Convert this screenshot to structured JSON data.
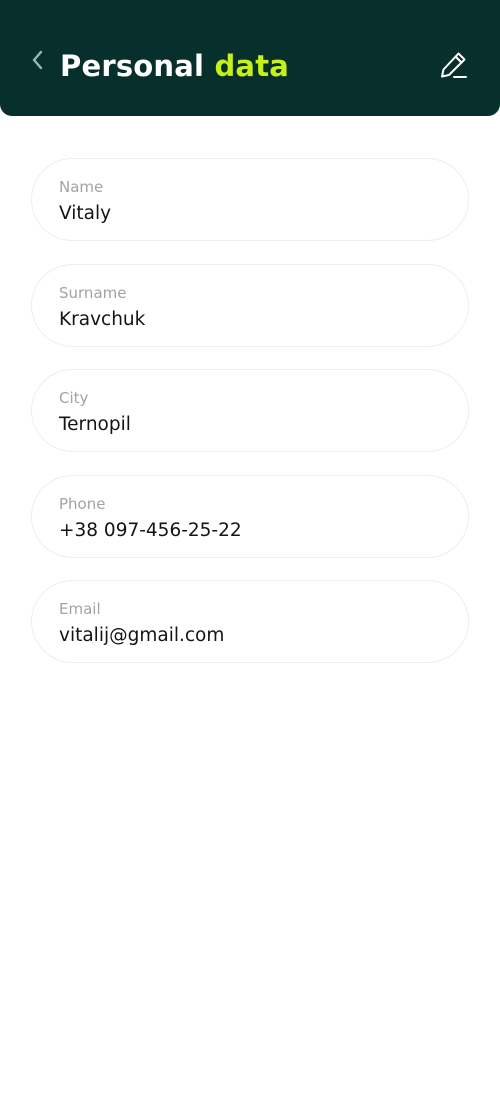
{
  "header": {
    "title_main": "Personal",
    "title_accent": "data",
    "back_icon": "chevron-left-icon",
    "edit_icon": "pencil-icon",
    "colors": {
      "background": "#07302c",
      "accent": "#c6f01a",
      "text": "#ffffff"
    }
  },
  "fields": [
    {
      "label": "Name",
      "value": "Vitaly"
    },
    {
      "label": "Surname",
      "value": "Kravchuk"
    },
    {
      "label": "City",
      "value": "Ternopil"
    },
    {
      "label": "Phone",
      "value": "+38 097-456-25-22"
    },
    {
      "label": "Email",
      "value": "vitalij@gmail.com"
    }
  ]
}
